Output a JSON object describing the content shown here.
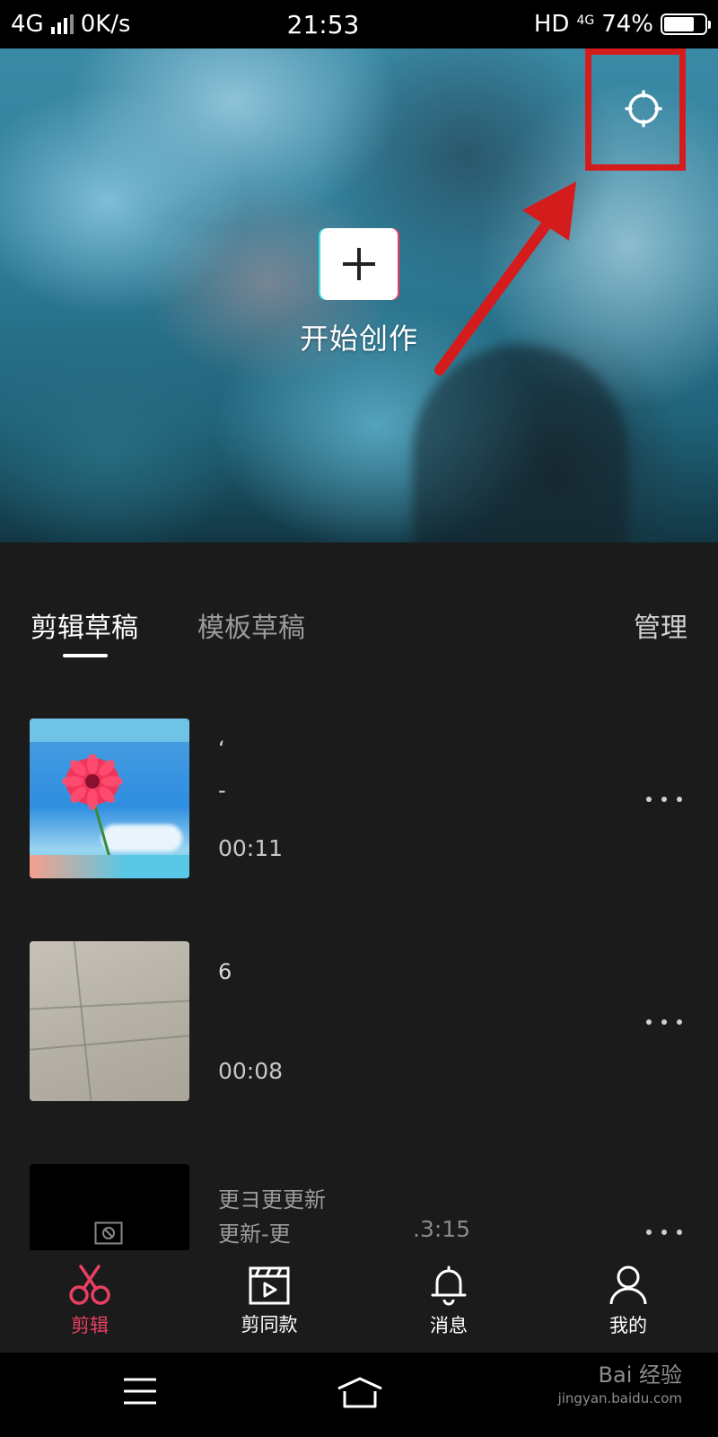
{
  "status_bar": {
    "network": "4G",
    "speed": "0K/s",
    "time": "21:53",
    "hd": "HD",
    "net_small": "4G",
    "battery": "74%",
    "battery_level": 0.74
  },
  "hero": {
    "create_label": "开始创作"
  },
  "tabs": {
    "active": "剪辑草稿",
    "inactive": "模板草稿",
    "manage": "管理"
  },
  "drafts": [
    {
      "title": "‘",
      "subtitle": "-",
      "duration": "00:11"
    },
    {
      "title": "6",
      "duration": "00:08"
    },
    {
      "title": "更ヨ更更新",
      "subtitle": "更新-更",
      "duration": ".3:15"
    }
  ],
  "bottom_nav": {
    "items": [
      {
        "label": "剪辑",
        "icon": "scissors-icon",
        "active": true
      },
      {
        "label": "剪同款",
        "icon": "clapperboard-icon",
        "active": false
      },
      {
        "label": "消息",
        "icon": "bell-icon",
        "active": false
      },
      {
        "label": "我的",
        "icon": "person-icon",
        "active": false
      }
    ]
  },
  "watermark": {
    "line1": "Bai 经验",
    "line2": "jingyan.baidu.com"
  },
  "colors": {
    "accent": "#ea3f63",
    "annotation": "#d51c1c",
    "background": "#1b1b1b"
  }
}
